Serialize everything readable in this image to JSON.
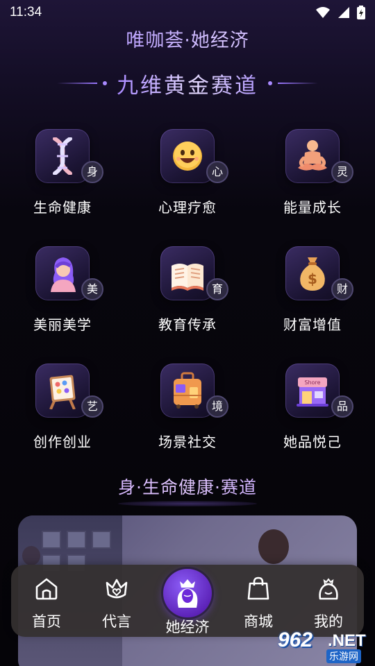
{
  "status": {
    "time": "11:34",
    "icons": [
      "wifi-icon",
      "signal-icon",
      "battery-icon"
    ]
  },
  "header": {
    "app_title": "唯咖荟·她经济",
    "section_title": "九维黄金赛道"
  },
  "categories": [
    {
      "label": "生命健康",
      "badge": "身",
      "icon": "dna-icon"
    },
    {
      "label": "心理疗愈",
      "badge": "心",
      "icon": "smile-face-icon"
    },
    {
      "label": "能量成长",
      "badge": "灵",
      "icon": "meditation-icon"
    },
    {
      "label": "美丽美学",
      "badge": "美",
      "icon": "woman-portrait-icon"
    },
    {
      "label": "教育传承",
      "badge": "育",
      "icon": "open-book-icon"
    },
    {
      "label": "财富增值",
      "badge": "财",
      "icon": "money-bag-icon"
    },
    {
      "label": "创作创业",
      "badge": "艺",
      "icon": "easel-icon"
    },
    {
      "label": "场景社交",
      "badge": "境",
      "icon": "suitcase-icon"
    },
    {
      "label": "她品悦己",
      "badge": "品",
      "icon": "shop-icon"
    }
  ],
  "subsection": {
    "title": "身·生命健康·赛道"
  },
  "nav": {
    "items": [
      {
        "label": "首页",
        "icon": "home-icon"
      },
      {
        "label": "代言",
        "icon": "crown-heart-icon"
      },
      {
        "label": "她经济",
        "icon": "queen-icon",
        "active": true
      },
      {
        "label": "商城",
        "icon": "shopping-bag-icon"
      },
      {
        "label": "我的",
        "icon": "profile-crown-icon"
      }
    ]
  },
  "watermark": {
    "num": "962",
    "net": ".NET",
    "sub": "乐游网"
  },
  "colors": {
    "accent": "#8b5cf6",
    "background": "#050408",
    "nav_bg": "#343030"
  }
}
